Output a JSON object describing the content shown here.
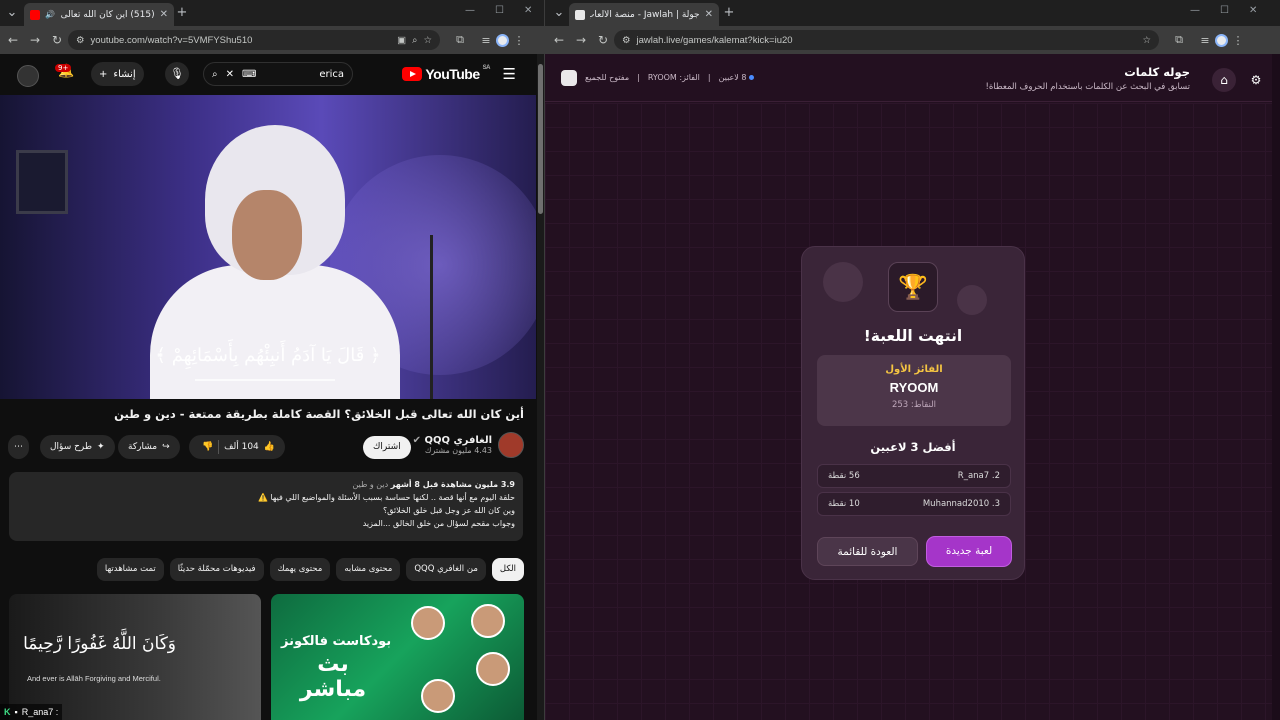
{
  "left_browser": {
    "tab_title": "(515) أين كان الله تعالى قبل ال...",
    "url": "youtube.com/watch?v=5VMFYShu510",
    "youtube": {
      "logo_text": "YouTube",
      "region": "SA",
      "search_query": "erica",
      "create_label": "إنشاء",
      "notif_count": "9+",
      "video_caption": "﴿ قَالَ يَا آدَمُ أَنبِئْهُم بِأَسْمَائِهِمْ ﴾",
      "video_title": "أين كان الله تعالى قبل الخلائق؟ القصة كاملة بطريقة ممتعة - دين و طين",
      "channel_name": "الغافري QQQ",
      "subscribers": "4.43 مليون مشترك",
      "subscribed_label": "اشتراك",
      "likes": "104 ألف",
      "share_label": "مشاركة",
      "ask_label": "طرح سؤال",
      "desc": {
        "views": "3.9 مليون مشاهدة",
        "age": "قبل 8 أشهر",
        "tags": "دين و طين",
        "line1": "حلقة اليوم مع أنها قصة .. لكنها حساسة بسبب الأسئلة والمواضيع اللي فيها ⚠️",
        "line2": "وين كان الله عز وجل قبل خلق الخلائق؟",
        "line3": "وجواب مقحم لسؤال من خلق الخالق ...المزيد"
      },
      "chips": [
        "الكل",
        "من الغافري QQQ",
        "محتوى مشابه",
        "محتوى يهمك",
        "فيديوهات محمّلة حديثًا",
        "تمت مشاهدتها"
      ],
      "rec1": {
        "arabic": "وَكَانَ اللَّهُ غَفُورًا رَّحِيمًا",
        "english": "And ever is Allāh Forgiving and Merciful."
      },
      "rec2": {
        "line1": "بودكاست فالكونز",
        "line2": "بث مباشر"
      }
    },
    "chat": {
      "user": "R_ana7 :"
    }
  },
  "right_browser": {
    "tab_title": "جولة | Jawlah - منصة الألعاب الت...",
    "url": "jawlah.live/games/kalemat?kick=iu20",
    "game": {
      "title": "جوله كلمات",
      "subtitle": "تسابق في البحث عن الكلمات باستخدام الحروف المعطاة!",
      "players": "8 لاعبين",
      "winner_label": "الفائز: RYOOM",
      "open_label": "مفتوح للجميع"
    },
    "result": {
      "title": "انتهت اللعبة!",
      "first_label": "الفائز الأول",
      "winner": "RYOOM",
      "winner_points": "النقاط: 253",
      "top_title": "أفضل 3 لاعبين",
      "rows": [
        {
          "name": "2. R_ana7",
          "points": "56 نقطة"
        },
        {
          "name": "3. Muhannad2010",
          "points": "10 نقطة"
        }
      ],
      "new_game": "لعبة جديدة",
      "back": "العودة للقائمة"
    }
  }
}
